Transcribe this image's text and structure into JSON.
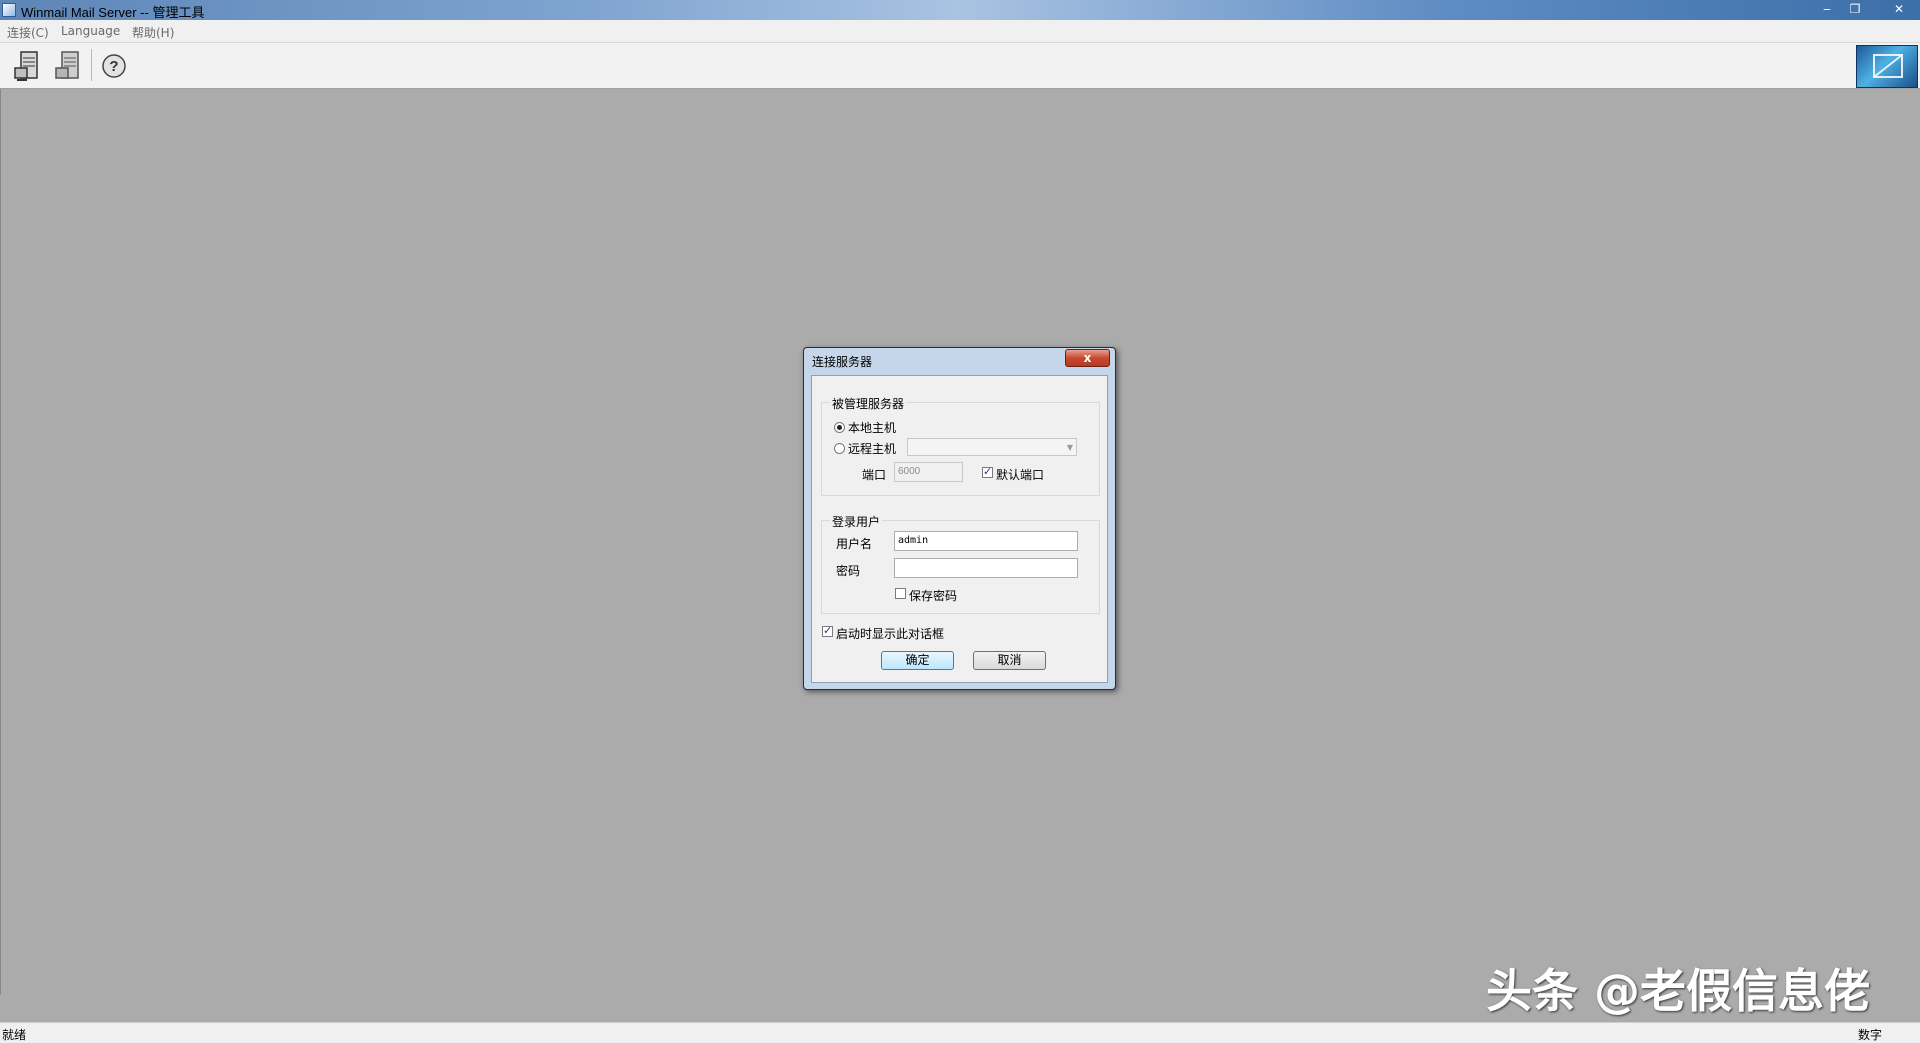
{
  "window": {
    "title": "Winmail Mail Server -- 管理工具",
    "minimize_glyph": "‒",
    "maximize_glyph": "❐",
    "close_glyph": "✕"
  },
  "menu": {
    "items": [
      {
        "label": "连接(C)"
      },
      {
        "label": "Language"
      },
      {
        "label": "帮助(H)"
      }
    ]
  },
  "toolbar": {
    "buttons": [
      {
        "icon": "connect-server-icon"
      },
      {
        "icon": "disconnect-server-icon"
      },
      {
        "icon": "help-icon"
      }
    ],
    "help_glyph": "?"
  },
  "dialog": {
    "title": "连接服务器",
    "close_glyph": "x",
    "server_group": {
      "label": "被管理服务器",
      "local_host_label": "本地主机",
      "local_host_selected": true,
      "remote_host_label": "远程主机",
      "remote_host_selected": false,
      "remote_host_value": "",
      "port_label": "端口",
      "port_value": "6000",
      "default_port_label": "默认端口",
      "default_port_checked": true
    },
    "login_group": {
      "label": "登录用户",
      "username_label": "用户名",
      "username_value": "admin",
      "password_label": "密码",
      "password_value": "",
      "save_password_label": "保存密码",
      "save_password_checked": false
    },
    "show_on_startup_label": "启动时显示此对话框",
    "show_on_startup_checked": true,
    "ok_label": "确定",
    "cancel_label": "取消"
  },
  "status": {
    "left": "就绪",
    "right": "数字"
  },
  "watermark": "头条 @老假信息佬"
}
